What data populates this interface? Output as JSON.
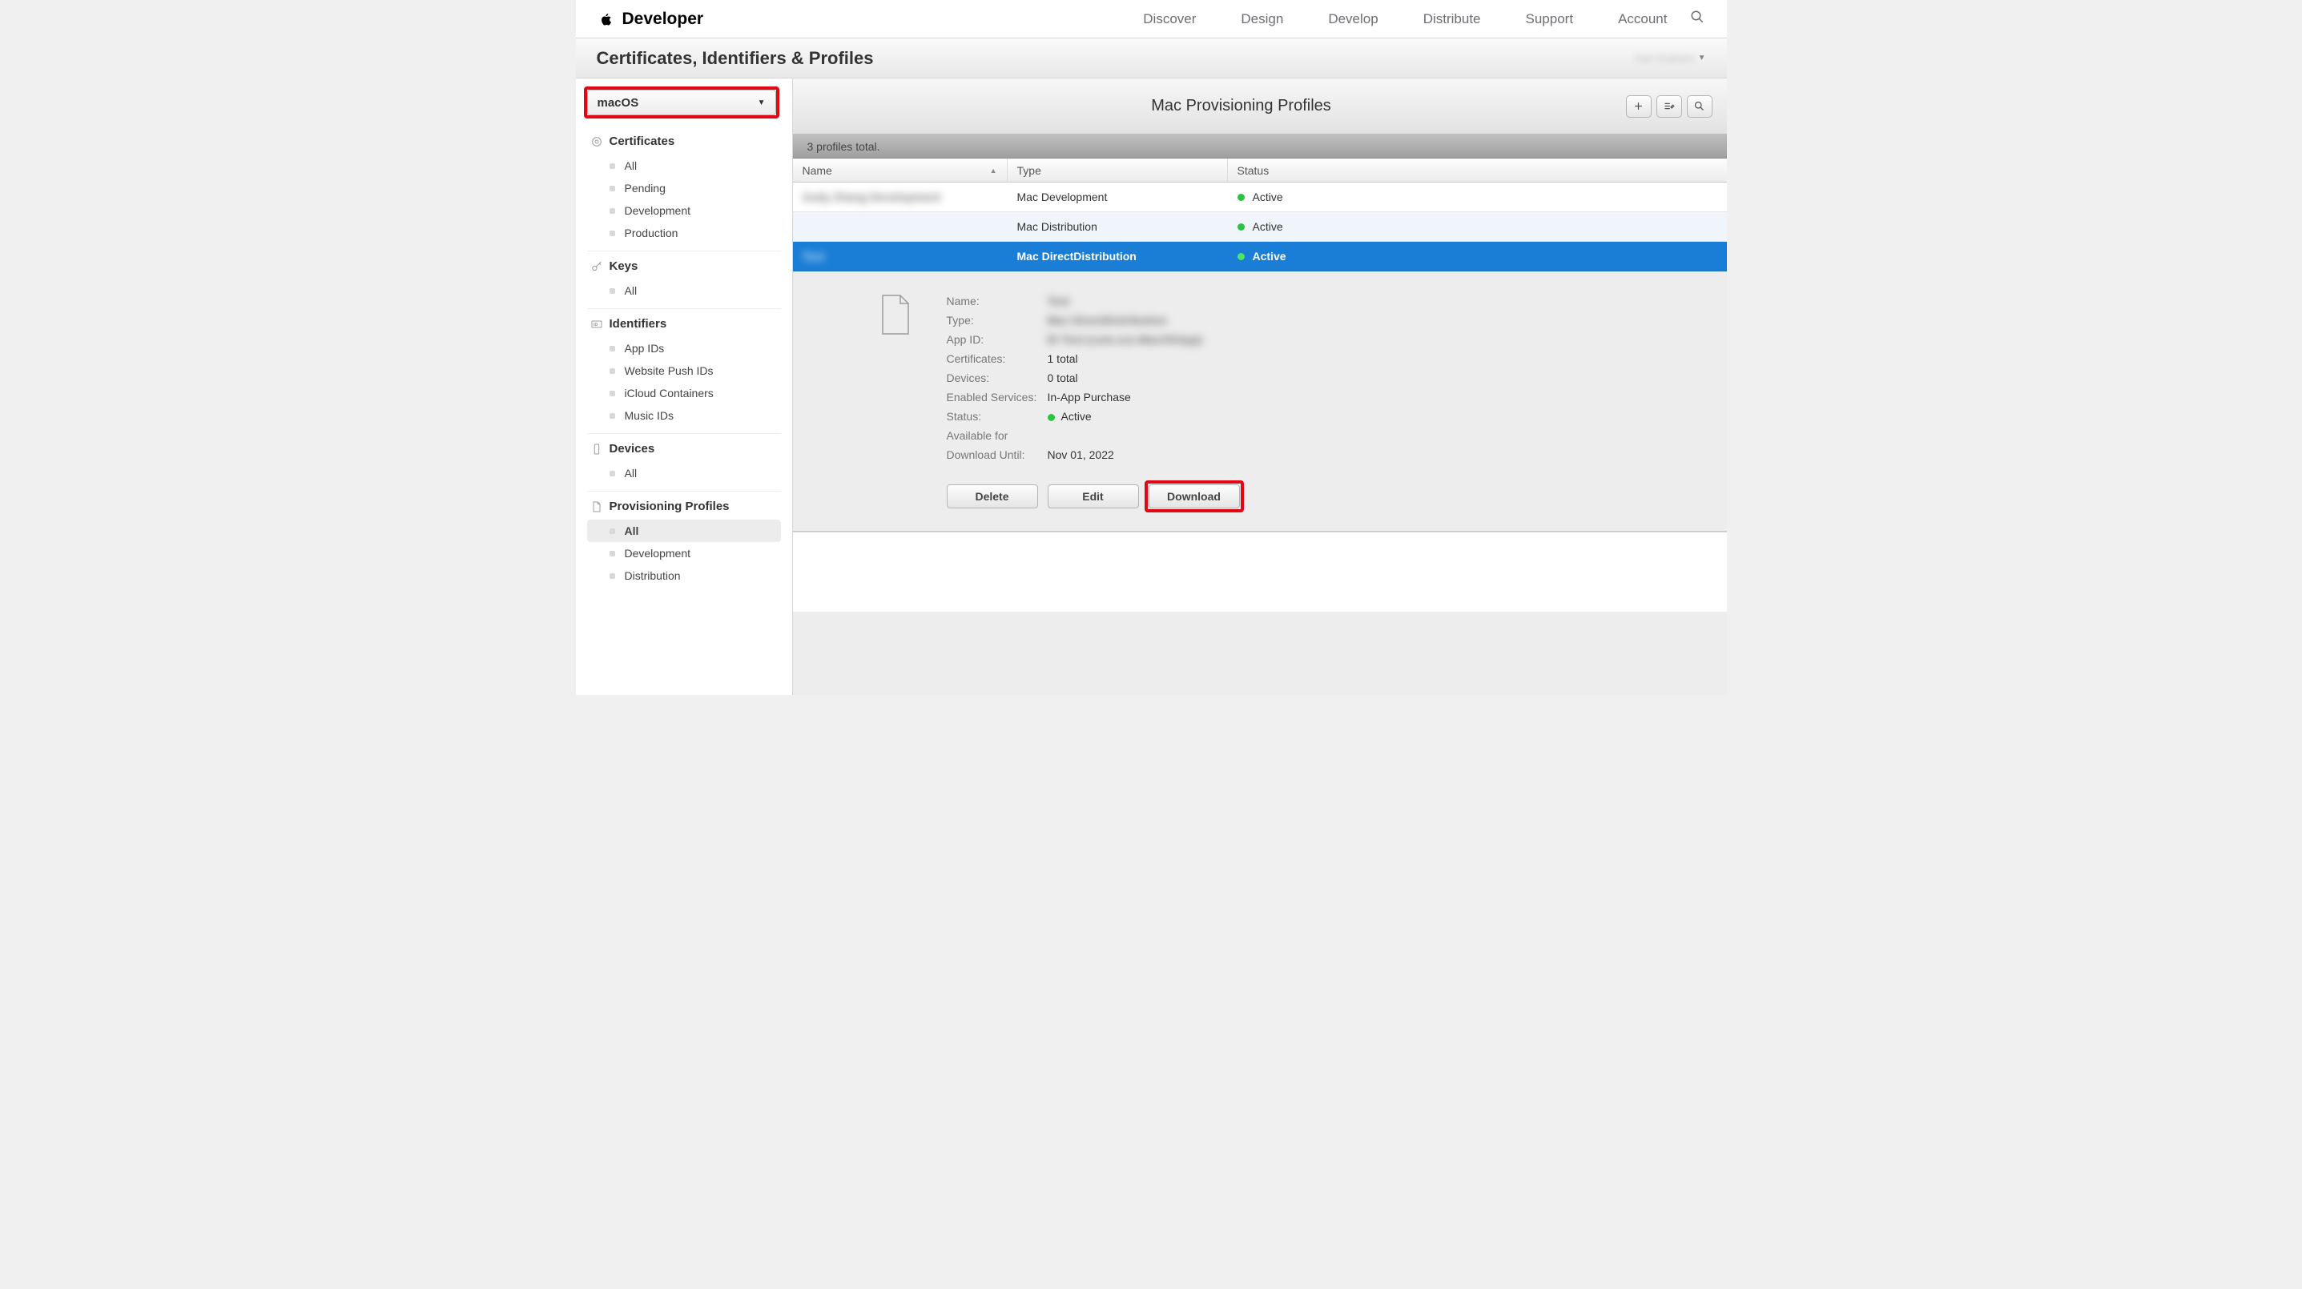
{
  "topnav": {
    "brand": "Developer",
    "items": [
      "Discover",
      "Design",
      "Develop",
      "Distribute",
      "Support",
      "Account"
    ]
  },
  "pagebar": {
    "title": "Certificates, Identifiers & Profiles",
    "user": "Karl Graham"
  },
  "sidebar": {
    "platform": "macOS",
    "sections": [
      {
        "title": "Certificates",
        "items": [
          "All",
          "Pending",
          "Development",
          "Production"
        ]
      },
      {
        "title": "Keys",
        "items": [
          "All"
        ]
      },
      {
        "title": "Identifiers",
        "items": [
          "App IDs",
          "Website Push IDs",
          "iCloud Containers",
          "Music IDs"
        ]
      },
      {
        "title": "Devices",
        "items": [
          "All"
        ]
      },
      {
        "title": "Provisioning Profiles",
        "items": [
          "All",
          "Development",
          "Distribution"
        ],
        "active": "All"
      }
    ]
  },
  "content": {
    "title": "Mac Provisioning Profiles",
    "count_text": "3 profiles total.",
    "columns": {
      "name": "Name",
      "type": "Type",
      "status": "Status"
    },
    "rows": [
      {
        "name": "Andy Zhang Development",
        "type": "Mac Development",
        "status": "Active",
        "selected": false
      },
      {
        "name": "",
        "type": "Mac Distribution",
        "status": "Active",
        "selected": false
      },
      {
        "name": "Test",
        "type": "Mac DirectDistribution",
        "status": "Active",
        "selected": true
      }
    ],
    "detail": {
      "name_label": "Name:",
      "name_value": "Test",
      "type_label": "Type:",
      "type_value": "Mac DirectDistribution",
      "appid_label": "App ID:",
      "appid_value": "ID Test (com.xxx.MacOSApp)",
      "cert_label": "Certificates:",
      "cert_value": "1 total",
      "dev_label": "Devices:",
      "dev_value": "0 total",
      "svc_label": "Enabled Services:",
      "svc_value": "In-App Purchase",
      "status_label": "Status:",
      "status_value": "Active",
      "avail_label_1": "Available for",
      "avail_label_2": "Download Until:",
      "avail_value": "Nov 01, 2022",
      "actions": {
        "delete": "Delete",
        "edit": "Edit",
        "download": "Download"
      }
    }
  }
}
